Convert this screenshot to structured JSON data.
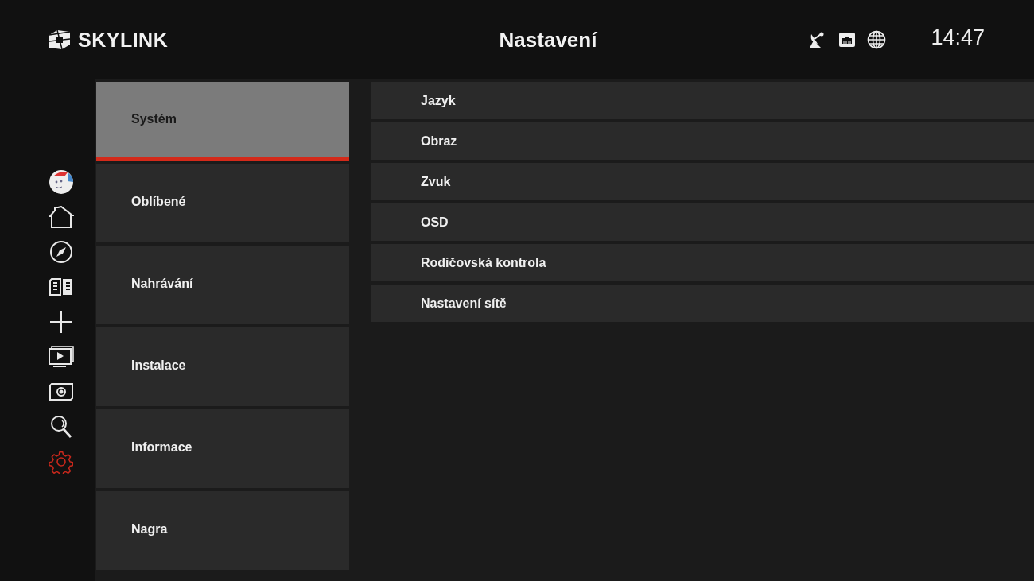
{
  "header": {
    "logo": "SKYLINK",
    "title": "Nastavení",
    "clock": "14:47"
  },
  "rail": [
    {
      "selected": false
    },
    {
      "selected": false
    },
    {
      "selected": false
    },
    {
      "selected": false
    },
    {
      "selected": false
    },
    {
      "selected": false
    },
    {
      "selected": false
    },
    {
      "selected": false
    },
    {
      "selected": true
    }
  ],
  "menu": [
    {
      "label": "Systém",
      "selected": true
    },
    {
      "label": "Oblíbené",
      "selected": false
    },
    {
      "label": "Nahrávání",
      "selected": false
    },
    {
      "label": "Instalace",
      "selected": false
    },
    {
      "label": "Informace",
      "selected": false
    },
    {
      "label": "Nagra",
      "selected": false
    }
  ],
  "submenu": [
    "Jazyk",
    "Obraz",
    "Zvuk",
    "OSD",
    "Rodičovská kontrola",
    "Nastavení sítě"
  ]
}
